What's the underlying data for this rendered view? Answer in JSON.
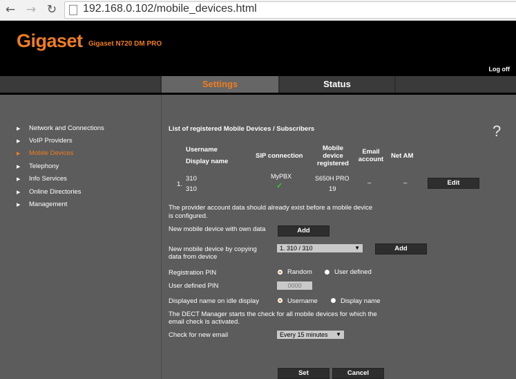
{
  "browser": {
    "url": "192.168.0.102/mobile_devices.html"
  },
  "header": {
    "logo": "Gigaset",
    "model": "Gigaset N720 DM PRO",
    "logoff": "Log off"
  },
  "tabs": {
    "settings": "Settings",
    "status": "Status"
  },
  "sidebar": {
    "items": [
      {
        "label": "Network and Connections"
      },
      {
        "label": "VoIP Providers"
      },
      {
        "label": "Mobile Devices"
      },
      {
        "label": "Telephony"
      },
      {
        "label": "Info Services"
      },
      {
        "label": "Online Directories"
      },
      {
        "label": "Management"
      }
    ]
  },
  "content": {
    "title": "List of registered Mobile Devices / Subscribers",
    "help": "?",
    "table": {
      "headers": {
        "username": "Username",
        "display_name": "Display name",
        "sip": "SIP connection",
        "device_l1": "Mobile",
        "device_l2": "device",
        "device_l3": "registered",
        "email_l1": "Email",
        "email_l2": "account",
        "netam": "Net AM"
      },
      "rows": [
        {
          "index": "1.",
          "username": "310",
          "display_name": "310",
          "sip": "MyPBX",
          "sip_check": "✓",
          "device_l1": "S650H PRO",
          "device_l2": "19",
          "email": "–",
          "netam": "–",
          "edit_label": "Edit"
        }
      ]
    },
    "provider_note_l1": "The provider account data should already exist before a mobile device",
    "provider_note_l2": "is configured.",
    "new_own_label": "New mobile device with own data",
    "add_label": "Add",
    "new_copy_l1": "New mobile device by copying",
    "new_copy_l2": "data from device",
    "copy_select": "1. 310 / 310",
    "reg_pin_label": "Registration PIN",
    "reg_pin_random": "Random",
    "reg_pin_user": "User defined",
    "user_pin_label": "User defined PIN",
    "user_pin_value": "0000",
    "idle_label": "Displayed name on idle display",
    "idle_username": "Username",
    "idle_display": "Display name",
    "dect_note_l1": "The DECT Manager starts the check for all mobile devices for which the",
    "dect_note_l2": "email check is activated.",
    "email_check_label": "Check for new email",
    "email_check_value": "Every 15 minutes",
    "set_label": "Set",
    "cancel_label": "Cancel"
  },
  "colors": {
    "accent": "#f07d1e",
    "panel": "#5c5c5c",
    "check": "#2bd12b"
  }
}
